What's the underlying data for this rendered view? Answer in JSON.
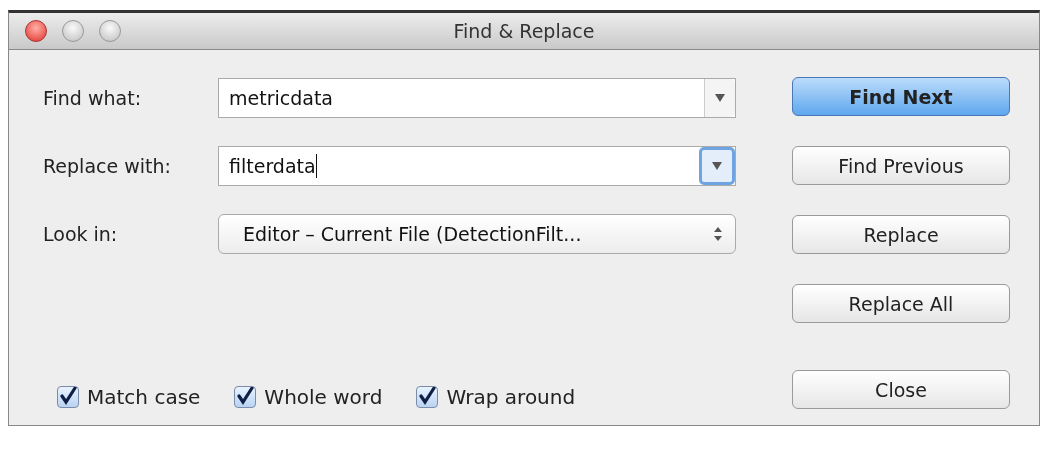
{
  "window": {
    "title": "Find & Replace"
  },
  "fields": [
    {
      "label": "Find what:",
      "kind": "combo",
      "value": "metricdata",
      "focused": false
    },
    {
      "label": "Replace with:",
      "kind": "combo",
      "value": "filterdata",
      "focused": true
    },
    {
      "label": "Look in:",
      "kind": "select",
      "value": "Editor – Current File (DetectionFilt..."
    }
  ],
  "buttons": [
    {
      "label": "Find Next",
      "default": true
    },
    {
      "label": "Find Previous",
      "default": false
    },
    {
      "label": "Replace",
      "default": false
    },
    {
      "label": "Replace All",
      "default": false
    },
    {
      "label": "Close",
      "default": false
    }
  ],
  "options": [
    {
      "label": "Match case",
      "checked": true
    },
    {
      "label": "Whole word",
      "checked": true
    },
    {
      "label": "Wrap around",
      "checked": true
    }
  ]
}
